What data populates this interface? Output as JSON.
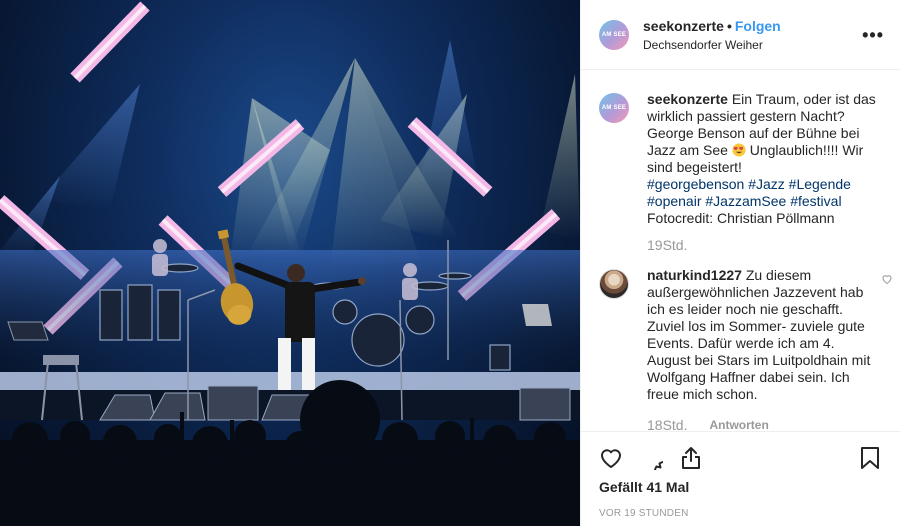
{
  "post": {
    "account": "seekonzerte",
    "avatar_text": "AM SEE",
    "separator": "•",
    "follow_label": "Folgen",
    "location": "Dechsendorfer Weiher",
    "more_label": "•••"
  },
  "caption": {
    "user": "seekonzerte",
    "text_before_emoji": "Ein Traum, oder ist das wirklich passiert gestern Nacht? George Benson auf der Bühne bei Jazz am See",
    "emoji": "heart-eyes-emoji",
    "text_after_emoji": "Unglaublich!!!! Wir sind begeistert!",
    "hashtags_line1": "#georgebenson #Jazz #Legende",
    "hashtags_line2": "#openair #JazzamSee #festival",
    "credit": "Fotocredit: Christian Pöllmann",
    "time": "19Std."
  },
  "comment": {
    "user": "naturkind1227",
    "text": "Zu diesem außergewöhnlichen Jazzevent hab ich es leider noch nie geschafft. Zuviel los im Sommer- zuviele gute Events. Dafür werde ich am 4. August bei Stars im Luitpoldhain mit Wolfgang Haffner dabei sein. Ich freue mich schon.",
    "time": "18Std.",
    "reply_label": "Antworten"
  },
  "footer": {
    "likes": "Gefällt 41 Mal",
    "posted": "VOR 19 STUNDEN",
    "icons": [
      "heart-icon",
      "comment-icon",
      "share-icon",
      "bookmark-icon"
    ]
  },
  "colors": {
    "link": "#3897f0",
    "hashtag": "#003569",
    "muted": "#999999",
    "stage_light": "#f3b8e6"
  }
}
